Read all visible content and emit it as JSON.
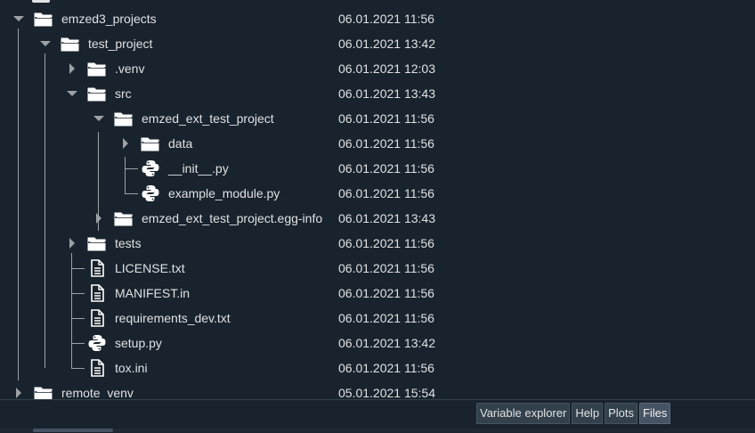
{
  "colors": {
    "background": "#19232d",
    "text": "#e0e1e3",
    "tree_line": "#9da1a6",
    "tab_background": "#32414b",
    "tab_active": "#455364"
  },
  "file_tree": {
    "rows": [
      {
        "name": "emzed3_projects",
        "date": "06.01.2021 11:56",
        "type": "folder",
        "expanded": true
      },
      {
        "name": "test_project",
        "date": "06.01.2021 13:42",
        "type": "folder",
        "expanded": true
      },
      {
        "name": ".venv",
        "date": "06.01.2021 12:03",
        "type": "folder",
        "expanded": false
      },
      {
        "name": "src",
        "date": "06.01.2021 13:43",
        "type": "folder",
        "expanded": true
      },
      {
        "name": "emzed_ext_test_project",
        "date": "06.01.2021 11:56",
        "type": "folder",
        "expanded": true
      },
      {
        "name": "data",
        "date": "06.01.2021 11:56",
        "type": "folder",
        "expanded": false
      },
      {
        "name": "__init__.py",
        "date": "06.01.2021 11:56",
        "type": "python"
      },
      {
        "name": "example_module.py",
        "date": "06.01.2021 11:56",
        "type": "python"
      },
      {
        "name": "emzed_ext_test_project.egg-info",
        "date": "06.01.2021 13:43",
        "type": "folder",
        "expanded": false
      },
      {
        "name": "tests",
        "date": "06.01.2021 11:56",
        "type": "folder",
        "expanded": false
      },
      {
        "name": "LICENSE.txt",
        "date": "06.01.2021 11:56",
        "type": "text"
      },
      {
        "name": "MANIFEST.in",
        "date": "06.01.2021 11:56",
        "type": "text"
      },
      {
        "name": "requirements_dev.txt",
        "date": "06.01.2021 11:56",
        "type": "text"
      },
      {
        "name": "setup.py",
        "date": "06.01.2021 13:42",
        "type": "python"
      },
      {
        "name": "tox.ini",
        "date": "06.01.2021 11:56",
        "type": "text"
      },
      {
        "name": "remote_venv",
        "date": "05.01.2021 15:54",
        "type": "folder",
        "expanded": false
      }
    ]
  },
  "tabs": [
    {
      "label": "Variable explorer",
      "active": false
    },
    {
      "label": "Help",
      "active": false
    },
    {
      "label": "Plots",
      "active": false
    },
    {
      "label": "Files",
      "active": true
    }
  ]
}
